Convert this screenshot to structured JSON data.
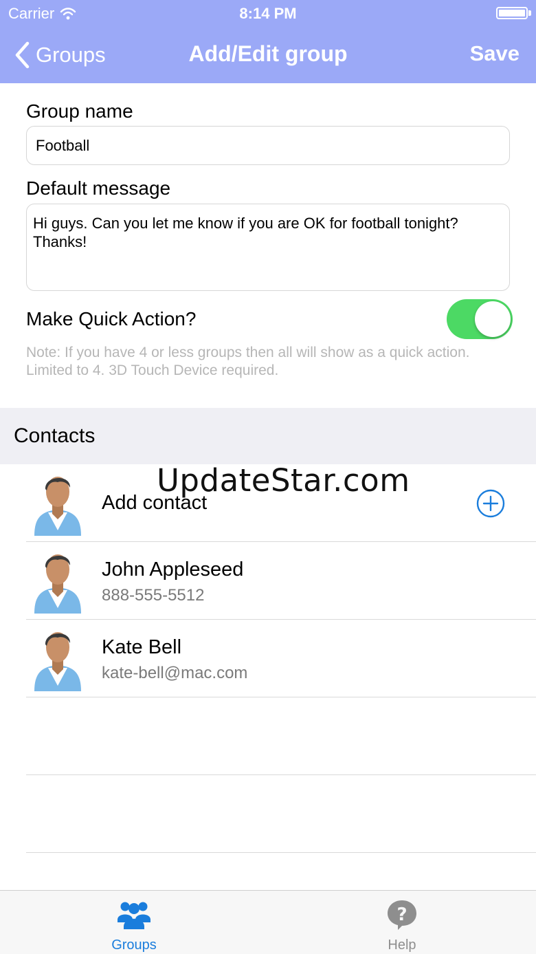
{
  "status_bar": {
    "carrier": "Carrier",
    "time": "8:14 PM"
  },
  "nav": {
    "back_label": "Groups",
    "title": "Add/Edit group",
    "save_label": "Save"
  },
  "form": {
    "group_name_label": "Group name",
    "group_name_value": "Football",
    "default_message_label": "Default message",
    "default_message_value": "Hi guys. Can you let me know if you are OK for football tonight? Thanks!",
    "quick_action_label": "Make Quick Action?",
    "quick_action_on": true,
    "note": "Note: If you have 4 or less groups then all will show as a quick action. Limited to 4. 3D Touch Device required."
  },
  "contacts": {
    "section_title": "Contacts",
    "add_label": "Add contact",
    "items": [
      {
        "name": "John Appleseed",
        "detail": "888-555-5512"
      },
      {
        "name": "Kate Bell",
        "detail": "kate-bell@mac.com"
      }
    ]
  },
  "watermark": "UpdateStar.com",
  "tabbar": {
    "items": [
      {
        "label": "Groups",
        "icon": "people-icon",
        "active": true
      },
      {
        "label": "Help",
        "icon": "question-bubble-icon",
        "active": false
      }
    ]
  },
  "colors": {
    "nav_bg": "#9ba9f7",
    "toggle_on": "#4cd964",
    "accent": "#1a7ddc",
    "inactive": "#8e8e8e"
  }
}
